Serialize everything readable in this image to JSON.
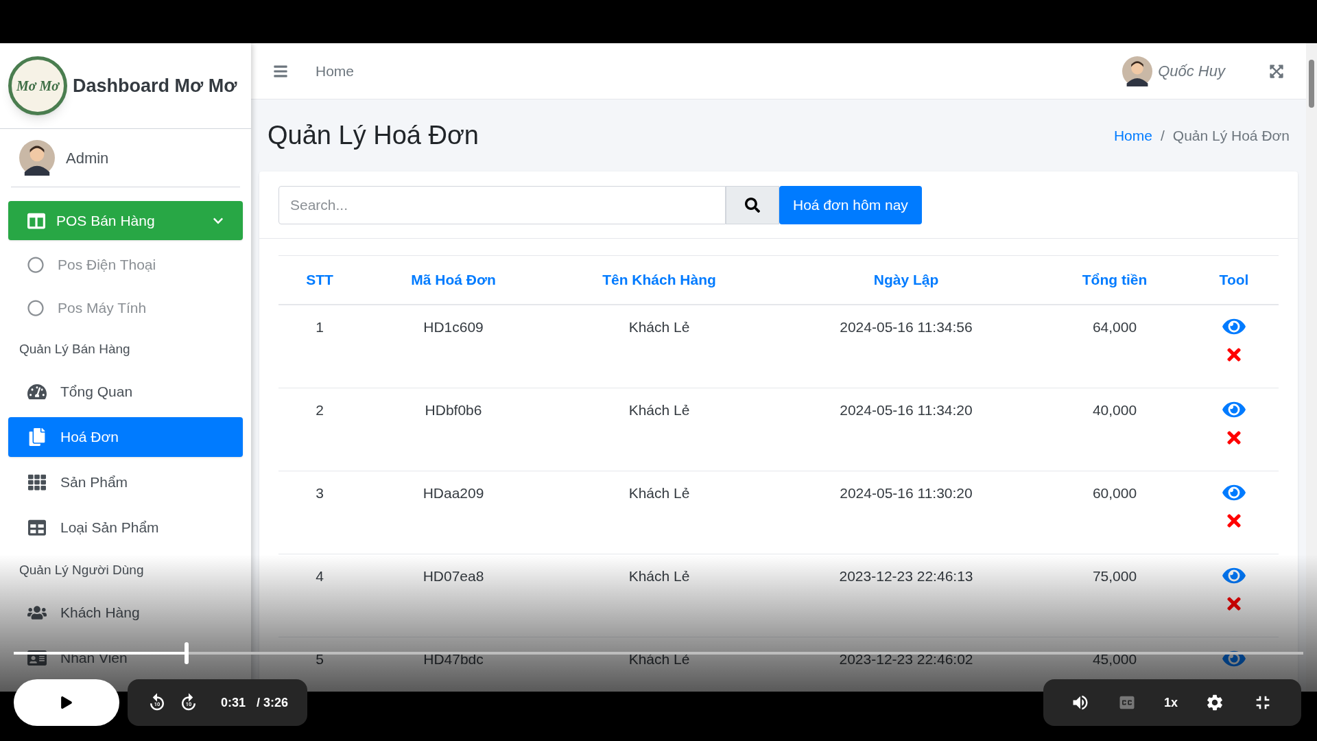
{
  "sidebar": {
    "logo_text": "Mơ Mơ",
    "brand": "Dashboard Mơ Mơ",
    "user": "Admin",
    "items": [
      {
        "kind": "menu",
        "label": "POS Bán Hàng",
        "expanded": true
      },
      {
        "kind": "sub",
        "label": "Pos Điện Thoại",
        "selected": false
      },
      {
        "kind": "sub",
        "label": "Pos Máy Tính",
        "selected": false
      },
      {
        "kind": "header",
        "label": "Quản Lý Bán Hàng"
      },
      {
        "kind": "link",
        "label": "Tổng Quan",
        "selected": false
      },
      {
        "kind": "link",
        "label": "Hoá Đơn",
        "selected": true
      },
      {
        "kind": "link",
        "label": "Sản Phẩm",
        "selected": false
      },
      {
        "kind": "link",
        "label": "Loại Sản Phẩm",
        "selected": false
      },
      {
        "kind": "header",
        "label": "Quản Lý Người Dùng"
      },
      {
        "kind": "link",
        "label": "Khách Hàng",
        "selected": false
      },
      {
        "kind": "link",
        "label": "Nhân Viên",
        "selected": false
      }
    ]
  },
  "topbar": {
    "nav": "Home",
    "user": "Quốc Huy"
  },
  "page": {
    "title": "Quản Lý Hoá Đơn",
    "breadcrumb": [
      "Home",
      "Quản Lý Hoá Đơn"
    ],
    "separator": "/"
  },
  "search": {
    "placeholder": "Search...",
    "button": "Hoá đơn hôm nay"
  },
  "table": {
    "columns": [
      "STT",
      "Mã Hoá Đơn",
      "Tên Khách Hàng",
      "Ngày Lập",
      "Tổng tiền",
      "Tool"
    ],
    "rows": [
      {
        "cells": [
          "1",
          "HD1c609",
          "Khách Lẻ",
          "2024-05-16 11:34:56",
          "64,000"
        ],
        "actions": [
          {
            "kind": "view"
          },
          {
            "kind": "delete"
          }
        ]
      },
      {
        "cells": [
          "2",
          "HDbf0b6",
          "Khách Lẻ",
          "2024-05-16 11:34:20",
          "40,000"
        ],
        "actions": [
          {
            "kind": "view"
          },
          {
            "kind": "delete"
          }
        ]
      },
      {
        "cells": [
          "3",
          "HDaa209",
          "Khách Lẻ",
          "2024-05-16 11:30:20",
          "60,000"
        ],
        "actions": [
          {
            "kind": "view"
          },
          {
            "kind": "delete"
          }
        ]
      },
      {
        "cells": [
          "4",
          "HD07ea8",
          "Khách Lẻ",
          "2023-12-23 22:46:13",
          "75,000"
        ],
        "actions": [
          {
            "kind": "view"
          },
          {
            "kind": "delete"
          }
        ]
      },
      {
        "cells": [
          "5",
          "HD47bdc",
          "Khách Lẻ",
          "2023-12-23 22:46:02",
          "45,000"
        ],
        "actions": [
          {
            "kind": "view"
          }
        ]
      }
    ]
  },
  "player": {
    "playing": false,
    "level": 0.134,
    "time": "0:31",
    "duration": "/ 3:26",
    "speed": "1x"
  }
}
